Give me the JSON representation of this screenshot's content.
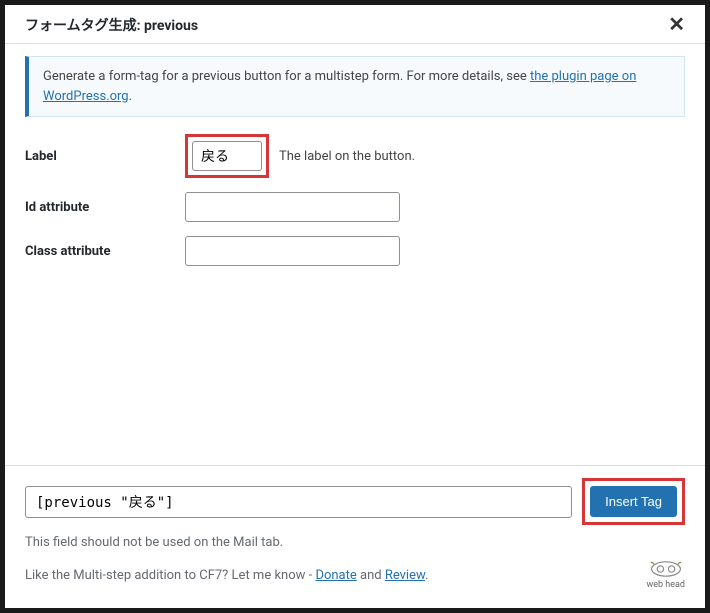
{
  "modal": {
    "title": "フォームタグ生成: previous"
  },
  "info": {
    "text_before": "Generate a form-tag for a previous button for a multistep form. For more details, see ",
    "link1": "the plugin page on WordPress.org",
    "text_after": "."
  },
  "form": {
    "label": {
      "label": "Label",
      "value": "戻る",
      "help": "The label on the button."
    },
    "id": {
      "label": "Id attribute",
      "value": ""
    },
    "class": {
      "label": "Class attribute",
      "value": ""
    }
  },
  "footer": {
    "tag_output": "[previous \"戻る\"]",
    "insert_button": "Insert Tag",
    "note": "This field should not be used on the Mail tab.",
    "credits_before": "Like the Multi-step addition to CF7? Let me know - ",
    "donate": "Donate",
    "and": " and ",
    "review": "Review",
    "period": ".",
    "logo_text": "web head"
  }
}
